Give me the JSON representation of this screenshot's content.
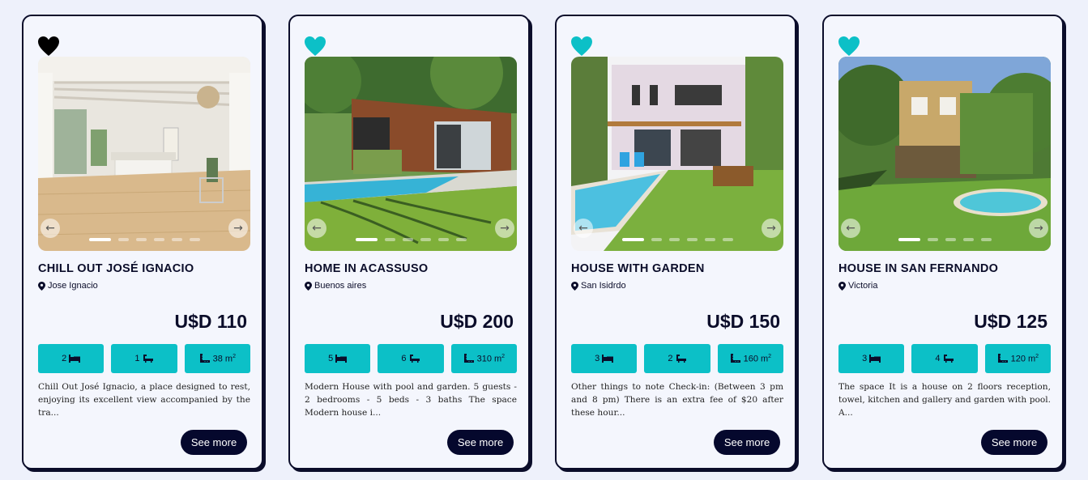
{
  "colors": {
    "accent": "#0cc0c7",
    "dark": "#0b0d2a",
    "button": "#05082d",
    "background": "#eef1fb"
  },
  "listings": [
    {
      "title": "CHILL OUT JOSÉ IGNACIO",
      "location": "Jose Ignacio",
      "price": "U$D 110",
      "favorited": true,
      "favorite_color": "#000000",
      "bedrooms": "2",
      "bathrooms": "1",
      "area": "38 m",
      "area_unit": "2",
      "description": "Chill Out José Ignacio, a place designed to rest, enjoying its excellent view accompanied by the tra...",
      "button_label": "See more",
      "icons": {
        "bed": "bed-icon",
        "bath": "bathtub-icon",
        "area": "ruler-icon",
        "location": "map-pin-icon",
        "favorite": "heart-icon"
      }
    },
    {
      "title": "HOME IN ACASSUSO",
      "location": "Buenos aires",
      "price": "U$D 200",
      "favorited": false,
      "favorite_color": "#0cc0c7",
      "bedrooms": "5",
      "bathrooms": "6",
      "area": "310 m",
      "area_unit": "2",
      "description": "Modern House with pool and garden. 5 guests - 2 bedrooms - 5 beds - 3 baths The space Modern house i...",
      "button_label": "See more",
      "icons": {
        "bed": "bed-icon",
        "bath": "bathtub-icon",
        "area": "ruler-icon",
        "location": "map-pin-icon",
        "favorite": "heart-icon"
      }
    },
    {
      "title": "HOUSE WITH GARDEN",
      "location": "San Isidrdo",
      "price": "U$D 150",
      "favorited": false,
      "favorite_color": "#0cc0c7",
      "bedrooms": "3",
      "bathrooms": "2",
      "area": "160 m",
      "area_unit": "2",
      "description": "Other things to note Check-in: (Between 3 pm and 8 pm) There is an extra fee of $20 after these hour...",
      "button_label": "See more",
      "icons": {
        "bed": "bed-icon",
        "bath": "bathtub-icon",
        "area": "ruler-icon",
        "location": "map-pin-icon",
        "favorite": "heart-icon"
      }
    },
    {
      "title": "HOUSE IN SAN FERNANDO",
      "location": "Victoria",
      "price": "U$D 125",
      "favorited": false,
      "favorite_color": "#0cc0c7",
      "bedrooms": "3",
      "bathrooms": "4",
      "area": "120 m",
      "area_unit": "2",
      "description": "The space It is a house on 2 floors reception, towel, kitchen and gallery and garden with pool. A...",
      "button_label": "See more",
      "icons": {
        "bed": "bed-icon",
        "bath": "bathtub-icon",
        "area": "ruler-icon",
        "location": "map-pin-icon",
        "favorite": "heart-icon"
      }
    }
  ]
}
